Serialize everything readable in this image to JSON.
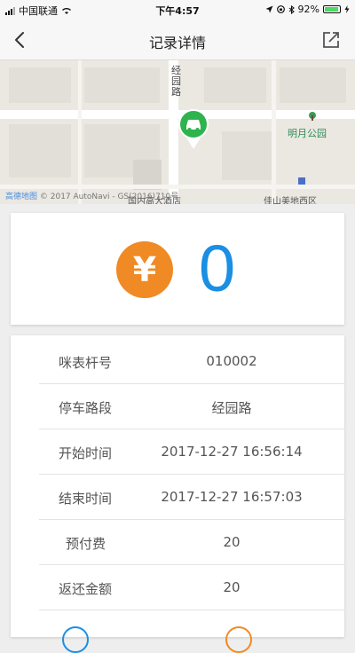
{
  "status_bar": {
    "carrier": "中国联通",
    "time": "下午4:57",
    "battery": "92%",
    "battery_level": 0.92
  },
  "nav": {
    "title": "记录详情",
    "back_icon": "chevron-left-icon",
    "share_icon": "share-icon"
  },
  "map": {
    "road_label": "经园路",
    "park_label": "明月公园",
    "poi_left": "国内高大酒店",
    "poi_right": "佳山美地西区",
    "copyright_brand": "高德地图",
    "copyright_text": "© 2017 AutoNavi - GS(2016)710号"
  },
  "amount": {
    "currency_symbol": "¥",
    "value": "0",
    "accent_color": "#f08a24",
    "value_color": "#1a8fe3"
  },
  "details": [
    {
      "label": "咪表杆号",
      "value": "010002"
    },
    {
      "label": "停车路段",
      "value": "经园路"
    },
    {
      "label": "开始时间",
      "value": "2017-12-27  16:56:14"
    },
    {
      "label": "结束时间",
      "value": "2017-12-27  16:57:03"
    },
    {
      "label": "预付费",
      "value": "20"
    },
    {
      "label": "返还金额",
      "value": "20"
    }
  ]
}
